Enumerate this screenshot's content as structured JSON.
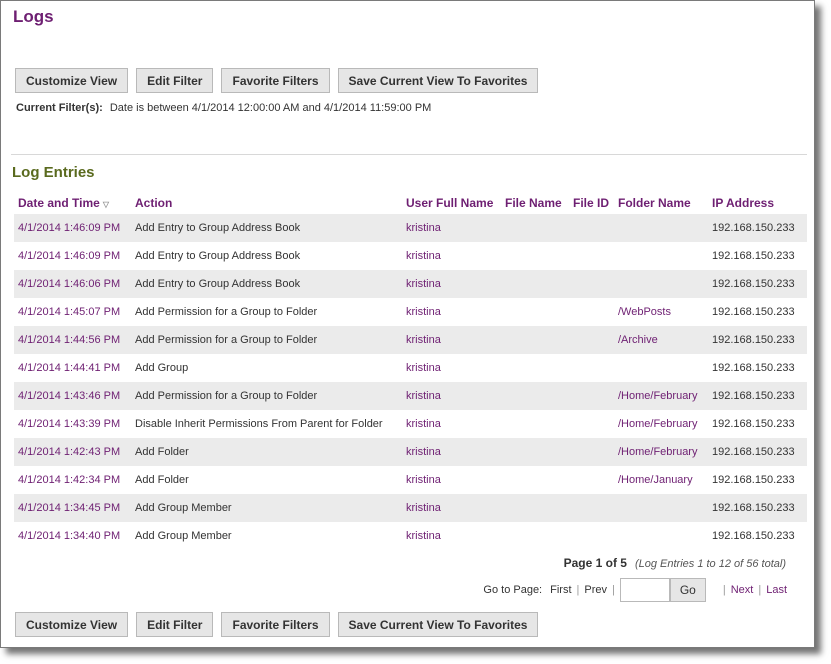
{
  "page": {
    "title": "Logs"
  },
  "toolbar": {
    "customize_view": "Customize View",
    "edit_filter": "Edit Filter",
    "favorite_filters": "Favorite Filters",
    "save_current_view": "Save Current View To Favorites"
  },
  "filter": {
    "label": "Current Filter(s):",
    "value": "Date is between 4/1/2014 12:00:00 AM and 4/1/2014 11:59:00 PM"
  },
  "log_entries": {
    "title": "Log Entries",
    "sort_icon": "sort-descending-icon",
    "columns": [
      "Date and Time",
      "Action",
      "User Full Name",
      "File Name",
      "File ID",
      "Folder Name",
      "IP Address"
    ],
    "rows": [
      {
        "date": "4/1/2014 1:46:09 PM",
        "action": "Add Entry to Group Address Book",
        "user": "kristina",
        "file_name": "",
        "file_id": "",
        "folder": "",
        "ip": "192.168.150.233"
      },
      {
        "date": "4/1/2014 1:46:09 PM",
        "action": "Add Entry to Group Address Book",
        "user": "kristina",
        "file_name": "",
        "file_id": "",
        "folder": "",
        "ip": "192.168.150.233"
      },
      {
        "date": "4/1/2014 1:46:06 PM",
        "action": "Add Entry to Group Address Book",
        "user": "kristina",
        "file_name": "",
        "file_id": "",
        "folder": "",
        "ip": "192.168.150.233"
      },
      {
        "date": "4/1/2014 1:45:07 PM",
        "action": "Add Permission for a Group to Folder",
        "user": "kristina",
        "file_name": "",
        "file_id": "",
        "folder": "/WebPosts",
        "ip": "192.168.150.233"
      },
      {
        "date": "4/1/2014 1:44:56 PM",
        "action": "Add Permission for a Group to Folder",
        "user": "kristina",
        "file_name": "",
        "file_id": "",
        "folder": "/Archive",
        "ip": "192.168.150.233"
      },
      {
        "date": "4/1/2014 1:44:41 PM",
        "action": "Add Group",
        "user": "kristina",
        "file_name": "",
        "file_id": "",
        "folder": "",
        "ip": "192.168.150.233"
      },
      {
        "date": "4/1/2014 1:43:46 PM",
        "action": "Add Permission for a Group to Folder",
        "user": "kristina",
        "file_name": "",
        "file_id": "",
        "folder": "/Home/February",
        "ip": "192.168.150.233"
      },
      {
        "date": "4/1/2014 1:43:39 PM",
        "action": "Disable Inherit Permissions From Parent for Folder",
        "user": "kristina",
        "file_name": "",
        "file_id": "",
        "folder": "/Home/February",
        "ip": "192.168.150.233"
      },
      {
        "date": "4/1/2014 1:42:43 PM",
        "action": "Add Folder",
        "user": "kristina",
        "file_name": "",
        "file_id": "",
        "folder": "/Home/February",
        "ip": "192.168.150.233"
      },
      {
        "date": "4/1/2014 1:42:34 PM",
        "action": "Add Folder",
        "user": "kristina",
        "file_name": "",
        "file_id": "",
        "folder": "/Home/January",
        "ip": "192.168.150.233"
      },
      {
        "date": "4/1/2014 1:34:45 PM",
        "action": "Add Group Member",
        "user": "kristina",
        "file_name": "",
        "file_id": "",
        "folder": "",
        "ip": "192.168.150.233"
      },
      {
        "date": "4/1/2014 1:34:40 PM",
        "action": "Add Group Member",
        "user": "kristina",
        "file_name": "",
        "file_id": "",
        "folder": "",
        "ip": "192.168.150.233"
      }
    ]
  },
  "pagination": {
    "page_label": "Page 1 of 5",
    "entries_label": "(Log Entries 1 to 12 of 56 total)",
    "goto_label": "Go to Page:",
    "first": "First",
    "prev": "Prev",
    "page_input_value": "",
    "go": "Go",
    "next": "Next",
    "last": "Last",
    "separator": "|"
  },
  "colors": {
    "accent": "#6e1f72",
    "section_title": "#5a6a1e",
    "row_alt": "#ebebeb"
  }
}
